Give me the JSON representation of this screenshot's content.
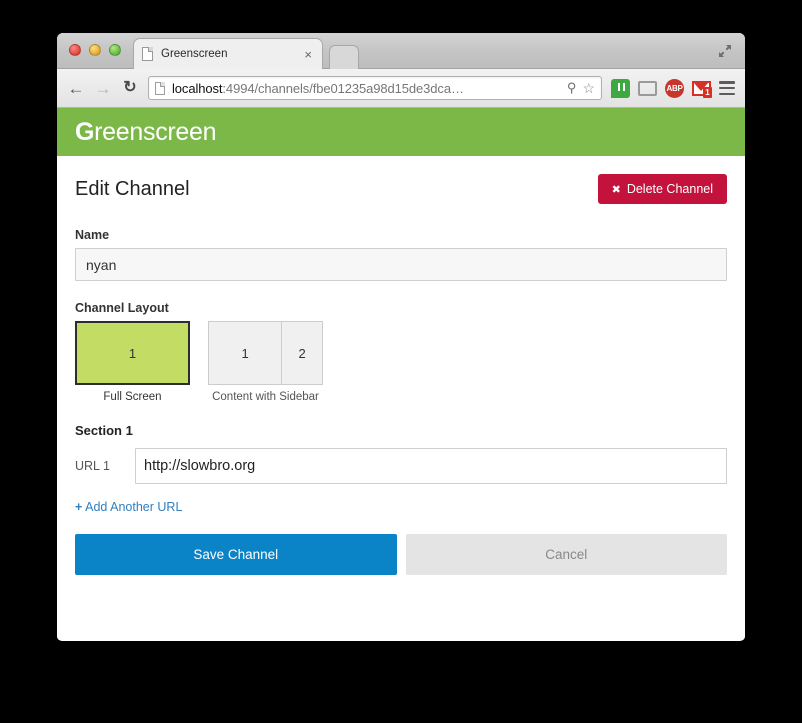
{
  "browser": {
    "tab": {
      "title": "Greenscreen",
      "close_label": "×"
    },
    "nav": {
      "back": "←",
      "forward": "→",
      "reload": "↻"
    },
    "omnibox": {
      "url_host": "localhost",
      "url_path": ":4994/channels/fbe01235a98d15de3dca…",
      "zoom_icon": "⚲",
      "star_icon": "☆"
    },
    "extensions": [
      {
        "name": "hangouts-extension-icon",
        "label": ""
      },
      {
        "name": "chromecast-extension-icon",
        "label": ""
      },
      {
        "name": "adblock-plus-extension-icon",
        "label": "ABP"
      },
      {
        "name": "gmail-extension-icon",
        "label": "",
        "badge": "1"
      },
      {
        "name": "chrome-menu-icon",
        "label": ""
      }
    ]
  },
  "app": {
    "logo_first_letter": "G",
    "logo_rest": "reenscreen",
    "brand_color": "#7cb848"
  },
  "main": {
    "page_title": "Edit Channel",
    "delete_button": {
      "label": "Delete Channel",
      "icon": "✖",
      "color": "#c3123c"
    },
    "name_field": {
      "label": "Name",
      "value": "nyan",
      "placeholder": "Name"
    },
    "layout_field": {
      "label": "Channel Layout",
      "options": [
        {
          "caption": "Full Screen",
          "cells": [
            "1"
          ],
          "selected": true
        },
        {
          "caption": "Content with Sidebar",
          "cells": [
            "1",
            "2"
          ],
          "selected": false
        }
      ],
      "selected_color": "#c3dc63"
    },
    "section": {
      "title": "Section 1",
      "url_label": "URL 1",
      "url_value": "http://slowbro.org",
      "url_placeholder": "http://",
      "add_url_label": "Add Another URL",
      "add_url_icon": "+",
      "add_url_color": "#2f7fc1"
    },
    "actions": {
      "save_label": "Save Channel",
      "save_color": "#0a84c6",
      "cancel_label": "Cancel",
      "cancel_color": "#e4e4e4"
    }
  }
}
